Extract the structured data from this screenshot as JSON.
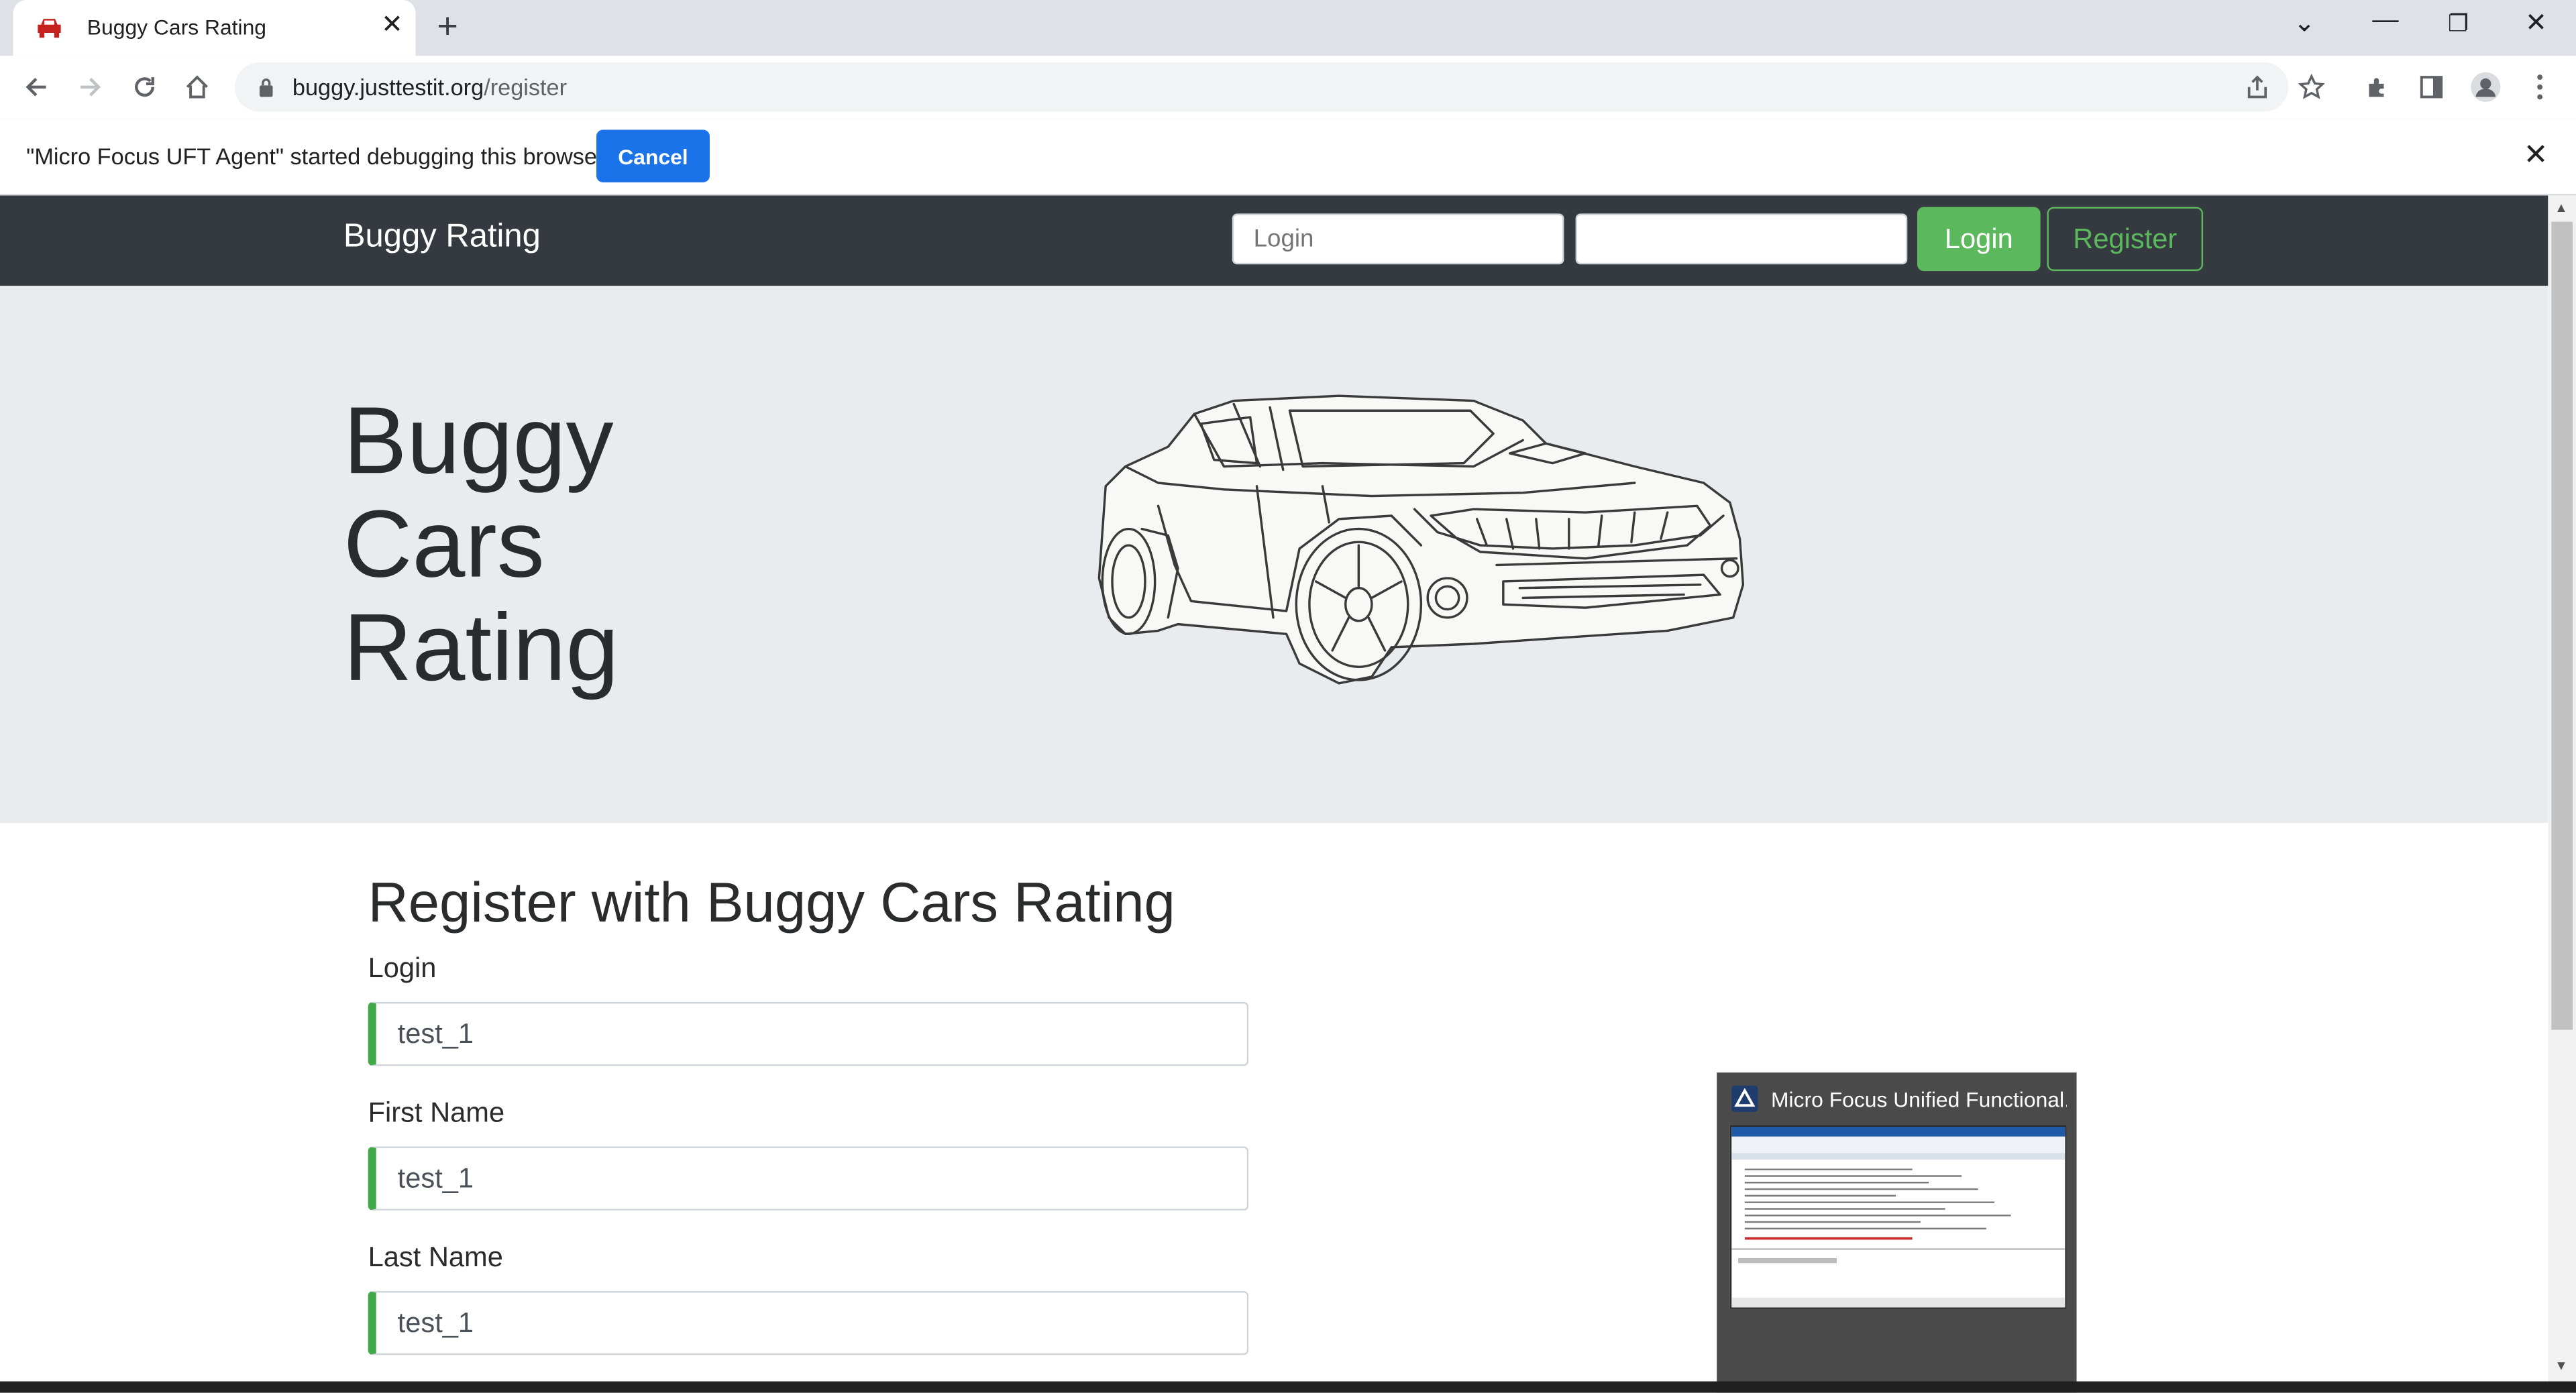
{
  "browser": {
    "tab_title": "Buggy Cars Rating",
    "url_host": "buggy.justtestit.org",
    "url_path": "/register"
  },
  "infobar": {
    "message": "\"Micro Focus UFT Agent\" started debugging this browser",
    "cancel_label": "Cancel"
  },
  "navbar": {
    "brand": "Buggy Rating",
    "login_placeholder": "Login",
    "password_placeholder": "",
    "login_button": "Login",
    "register_button": "Register"
  },
  "hero": {
    "title_lines": [
      "Buggy",
      "Cars",
      "Rating"
    ]
  },
  "form": {
    "heading": "Register with Buggy Cars Rating",
    "fields": [
      {
        "label": "Login",
        "value": "test_1"
      },
      {
        "label": "First Name",
        "value": "test_1"
      },
      {
        "label": "Last Name",
        "value": "test_1"
      }
    ]
  },
  "taskbar_preview": {
    "title": "Micro Focus Unified Functional..."
  },
  "colors": {
    "navbar_bg": "#343a40",
    "accent_green": "#5cb85c",
    "valid_border": "#42a948",
    "chrome_blue": "#1a73e8"
  }
}
